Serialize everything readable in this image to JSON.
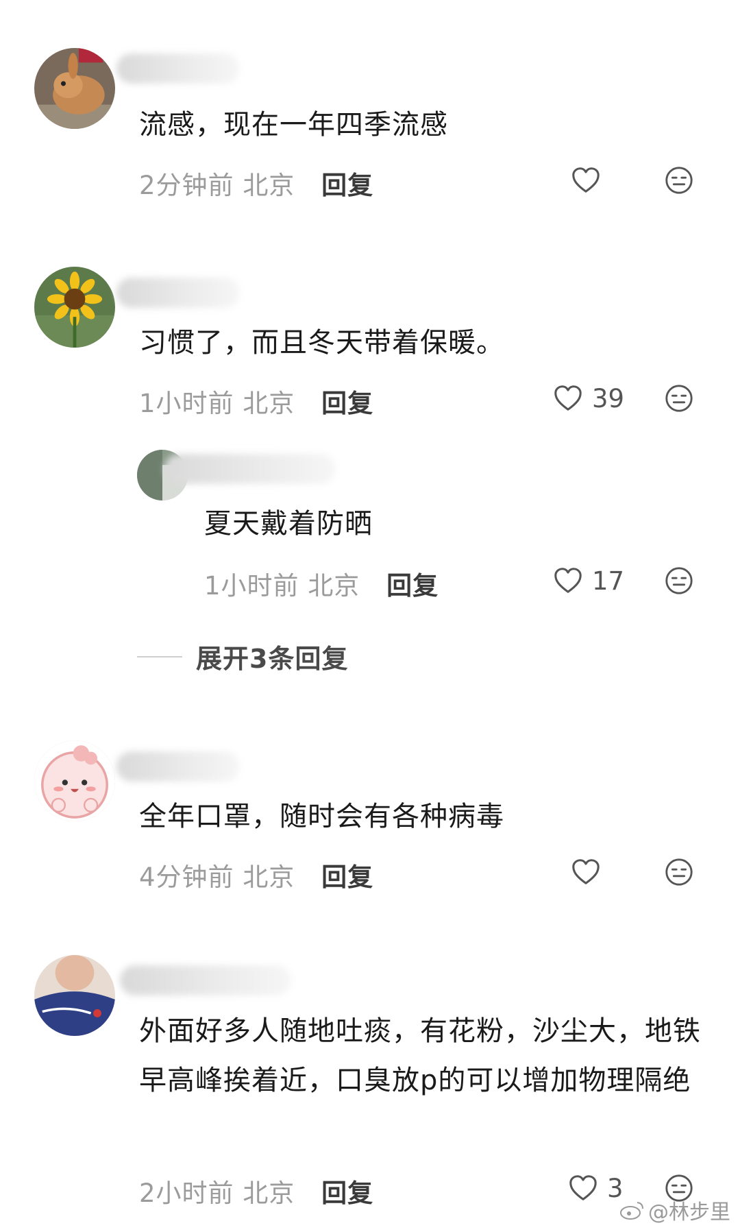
{
  "comments": [
    {
      "text": "流感，现在一年四季流感",
      "time": "2分钟前",
      "location": "北京",
      "reply_label": "回复",
      "likes": ""
    },
    {
      "text": "习惯了，而且冬天带着保暖。",
      "time": "1小时前",
      "location": "北京",
      "reply_label": "回复",
      "likes": "39",
      "replies": [
        {
          "text": "夏天戴着防晒",
          "time": "1小时前",
          "location": "北京",
          "reply_label": "回复",
          "likes": "17"
        }
      ],
      "expand_label": "展开3条回复"
    },
    {
      "text": "全年口罩，随时会有各种病毒",
      "time": "4分钟前",
      "location": "北京",
      "reply_label": "回复",
      "likes": ""
    },
    {
      "text": "外面好多人随地吐痰，有花粉，沙尘大，地铁早高峰挨着近，口臭放p的可以增加物理隔绝",
      "time": "2小时前",
      "location": "北京",
      "reply_label": "回复",
      "likes": "3"
    }
  ],
  "watermark": "@林步里",
  "icons": {
    "like": "heart-outline-icon",
    "dislike": "neutral-face-icon",
    "watermark": "weibo-logo-icon"
  }
}
